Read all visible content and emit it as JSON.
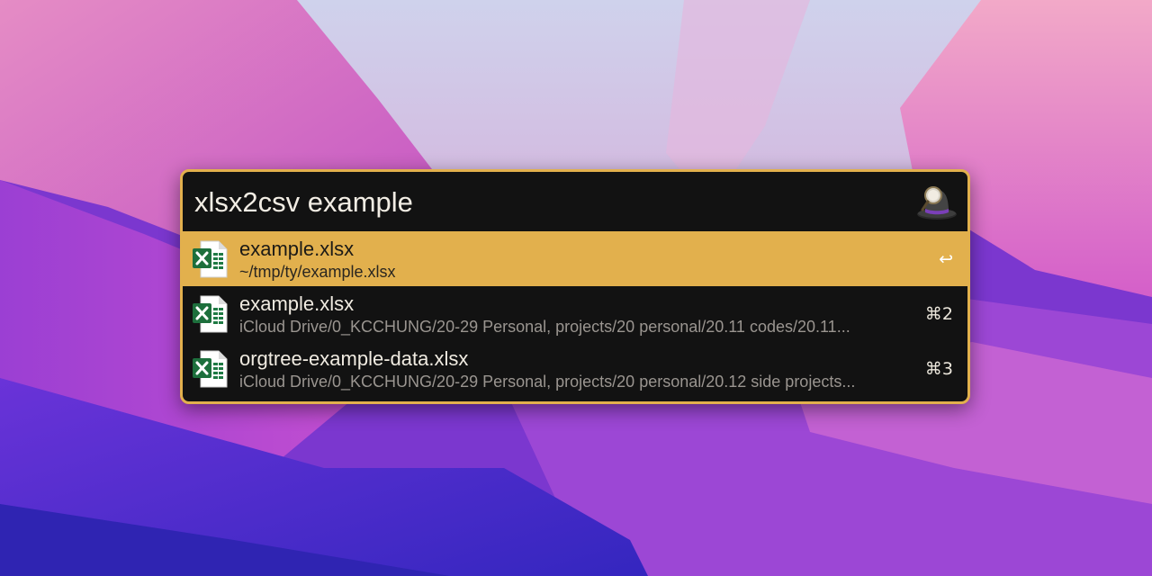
{
  "colors": {
    "accent": "#e2b04d",
    "panel_background": "#121212",
    "primary_text": "#f0ebe1",
    "secondary_text": "#9a9590"
  },
  "launcher": {
    "query": "xlsx2csv example",
    "logo_icon": "alfred-hat-icon"
  },
  "results": [
    {
      "icon": "excel-file-icon",
      "title": "example.xlsx",
      "subtitle": "~/tmp/ty/example.xlsx",
      "shortcut": "↩",
      "selected": true
    },
    {
      "icon": "excel-file-icon",
      "title": "example.xlsx",
      "subtitle": "iCloud Drive/0_KCCHUNG/20-29 Personal, projects/20 personal/20.11 codes/20.11...",
      "shortcut": "⌘2",
      "selected": false
    },
    {
      "icon": "excel-file-icon",
      "title": "orgtree-example-data.xlsx",
      "subtitle": "iCloud Drive/0_KCCHUNG/20-29 Personal, projects/20 personal/20.12 side projects...",
      "shortcut": "⌘3",
      "selected": false
    }
  ]
}
